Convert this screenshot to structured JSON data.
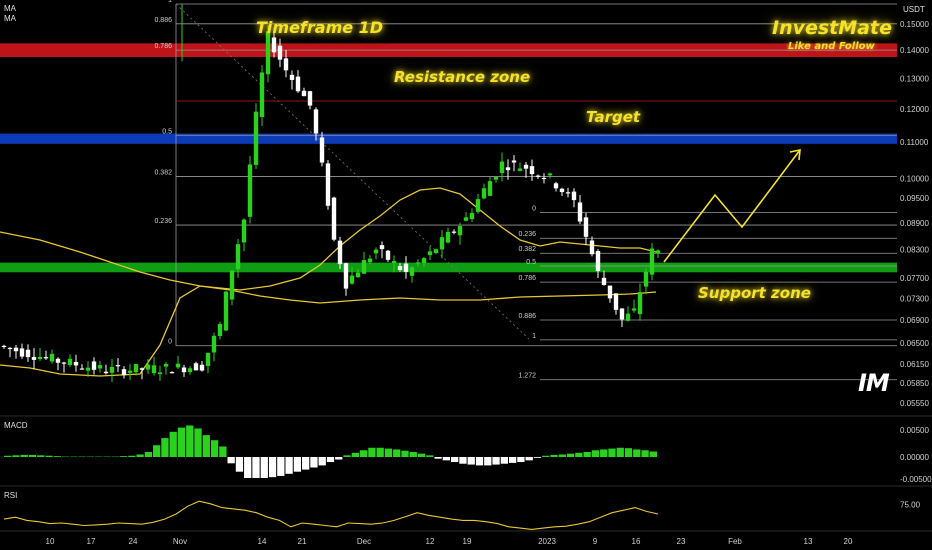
{
  "header": {
    "currency": "USDT",
    "ma_labels": [
      "MA",
      "MA"
    ]
  },
  "brand": {
    "title": "InvestMate",
    "subtitle": "Like and Follow",
    "logo": "IM"
  },
  "annotations": {
    "timeframe": "Timeframe 1D",
    "resistance": "Resistance zone",
    "target": "Target",
    "support": "Support zone"
  },
  "panels": {
    "macd": "MACD",
    "rsi": "RSI"
  },
  "colors": {
    "background": "#000000",
    "up_candle": "#2bd21d",
    "down_candle": "#ffffff",
    "resistance_zone": "#c8141a",
    "target_zone": "#0d3ebf",
    "support_zone": "#0fa514",
    "ma_line": "#e8c632",
    "annotation": "#f5e22a"
  },
  "chart_data": {
    "type": "candlestick",
    "timeframe": "1D",
    "x_tick_labels": [
      "10",
      "17",
      "24",
      "Nov",
      "14",
      "21",
      "Dec",
      "12",
      "19",
      "2023",
      "9",
      "16",
      "23",
      "Feb",
      "13",
      "20"
    ],
    "y_axis": {
      "scale": "log",
      "range": [
        0.0545,
        0.158
      ],
      "tick_labels": [
        "0.15000",
        "0.14000",
        "0.13000",
        "0.12000",
        "0.11000",
        "0.10000",
        "0.09500",
        "0.08900",
        "0.08300",
        "0.07700",
        "0.07300",
        "0.06900",
        "0.06500",
        "0.06150",
        "0.05850",
        "0.05550"
      ]
    },
    "price_summary": {
      "start": 0.0615,
      "high": 0.158,
      "low": 0.0555,
      "last": 0.0825
    },
    "zones": [
      {
        "name": "Resistance zone",
        "low": 0.1375,
        "high": 0.1425
      },
      {
        "name": "Target",
        "low": 0.1095,
        "high": 0.1125
      },
      {
        "name": "Support zone",
        "low": 0.0782,
        "high": 0.0802
      }
    ],
    "fib_levels_1": [
      {
        "label": "1",
        "price": 0.158
      },
      {
        "label": "0.886",
        "price": 0.15
      },
      {
        "label": "0.786",
        "price": 0.14
      },
      {
        "label": "0.5",
        "price": 0.112
      },
      {
        "label": "0.382",
        "price": 0.1005
      },
      {
        "label": "0.236",
        "price": 0.0885
      },
      {
        "label": "0",
        "price": 0.0645
      }
    ],
    "fib_levels_2": [
      {
        "label": "0",
        "price": 0.0915
      },
      {
        "label": "0.236",
        "price": 0.0855
      },
      {
        "label": "0.382",
        "price": 0.0822
      },
      {
        "label": "0.5",
        "price": 0.0795
      },
      {
        "label": "0.786",
        "price": 0.0762
      },
      {
        "label": "0.886",
        "price": 0.069
      },
      {
        "label": "1",
        "price": 0.0655
      },
      {
        "label": "1.272",
        "price": 0.059
      }
    ],
    "macd_axis_labels": [
      "0.00500",
      "0.00000",
      "-0.00500"
    ],
    "rsi_axis_labels": [
      "75.00"
    ],
    "macd_histogram": [
      0.0003,
      0.0004,
      0.0005,
      0.0005,
      0.0004,
      0.0003,
      0.0002,
      0.0001,
      0.0001,
      0.0001,
      0.0001,
      0.0001,
      0.0001,
      0.0001,
      0.0002,
      0.0003,
      0.0006,
      0.0012,
      0.0028,
      0.0045,
      0.006,
      0.007,
      0.0075,
      0.0068,
      0.0052,
      0.004,
      0.0025,
      -0.0015,
      -0.0035,
      -0.005,
      -0.005,
      -0.005,
      -0.0048,
      -0.0045,
      -0.004,
      -0.0035,
      -0.003,
      -0.0025,
      -0.002,
      -0.0012,
      -0.0006,
      0.0004,
      0.001,
      0.0016,
      0.0022,
      0.0022,
      0.002,
      0.0018,
      0.0015,
      0.0012,
      0.0008,
      0.0004,
      -0.0004,
      -0.0008,
      -0.0012,
      -0.0016,
      -0.0018,
      -0.002,
      -0.002,
      -0.0018,
      -0.0016,
      -0.0014,
      -0.0012,
      -0.0008,
      -0.0002,
      0.0003,
      0.0005,
      0.0006,
      0.0008,
      0.001,
      0.0012,
      0.0016,
      0.0018,
      0.002,
      0.0022,
      0.0021,
      0.0018,
      0.0016,
      0.0013
    ],
    "rsi": [
      52,
      55,
      50,
      48,
      45,
      46,
      44,
      42,
      43,
      44,
      46,
      45,
      44,
      47,
      52,
      60,
      72,
      80,
      76,
      70,
      68,
      66,
      62,
      55,
      50,
      40,
      46,
      44,
      42,
      40,
      46,
      45,
      44,
      46,
      50,
      56,
      62,
      58,
      55,
      52,
      50,
      50,
      48,
      45,
      40,
      38,
      36,
      38,
      40,
      41,
      44,
      48,
      55,
      62,
      66,
      70,
      64,
      60
    ]
  }
}
